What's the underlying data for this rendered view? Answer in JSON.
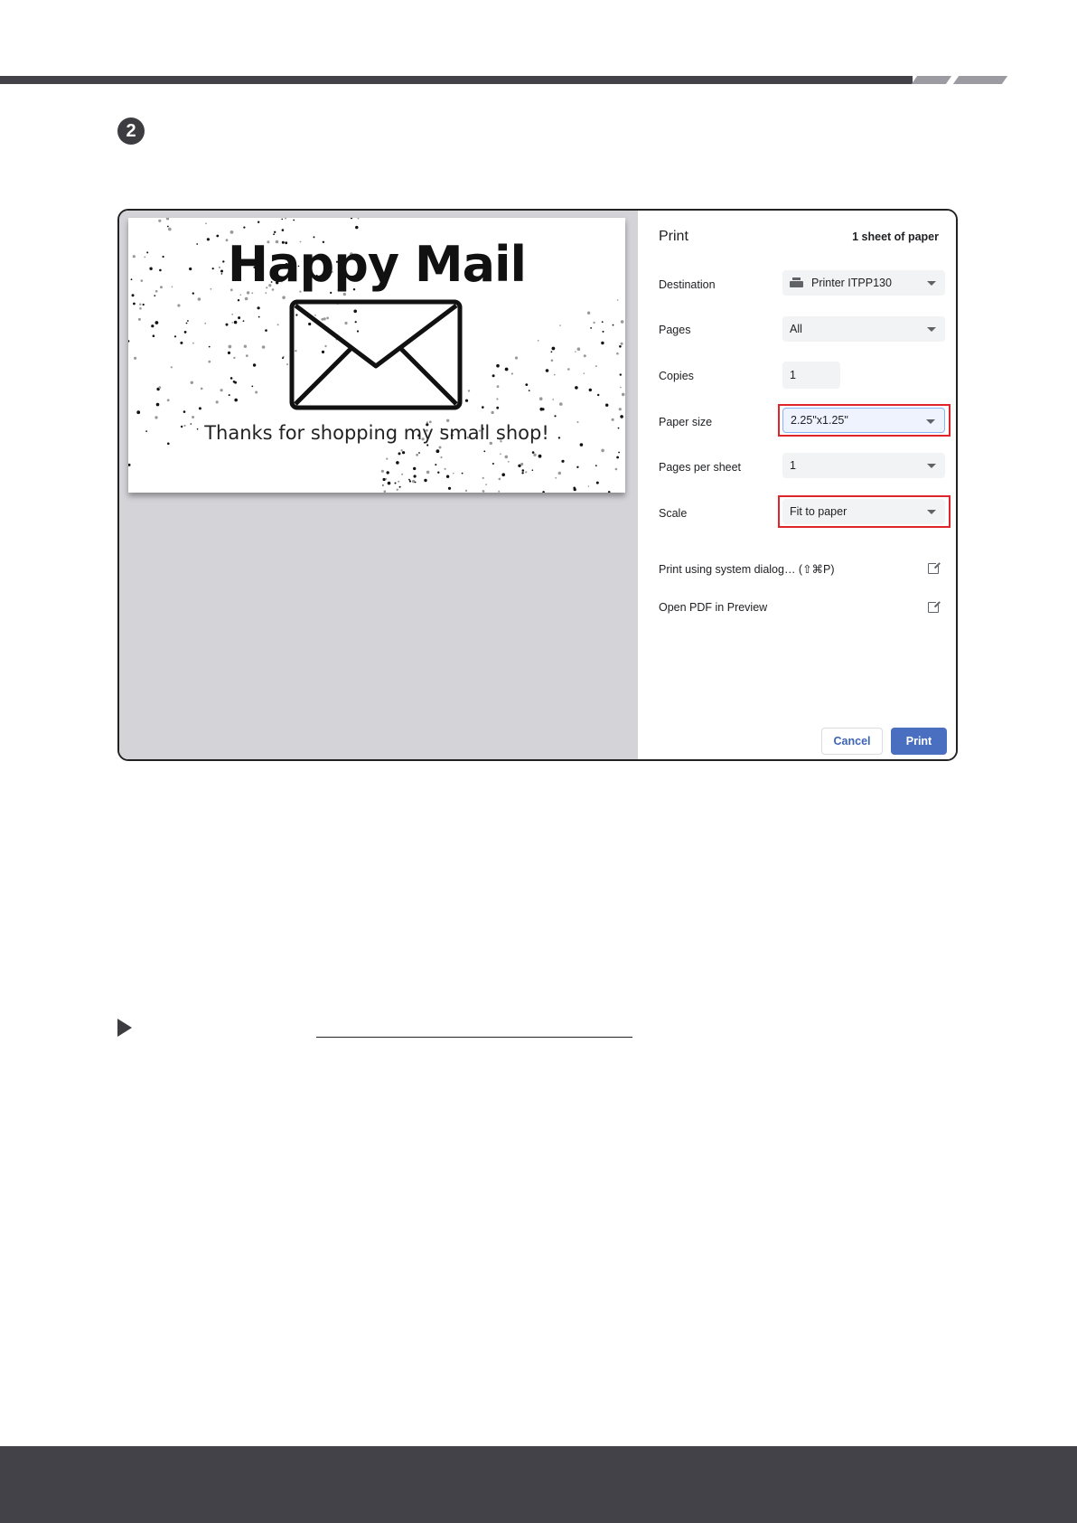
{
  "step": {
    "number": "2"
  },
  "preview": {
    "title": "Happy Mail",
    "message": "Thanks for shopping my small shop!"
  },
  "print_dialog": {
    "heading": "Print",
    "sheet_count": "1 sheet of paper",
    "destination": {
      "label": "Destination",
      "value": "Printer ITPP130"
    },
    "pages": {
      "label": "Pages",
      "value": "All"
    },
    "copies": {
      "label": "Copies",
      "value": "1"
    },
    "paper_size": {
      "label": "Paper size",
      "value": "2.25\"x1.25\""
    },
    "pages_per_sheet": {
      "label": "Pages per sheet",
      "value": "1"
    },
    "scale": {
      "label": "Scale",
      "value": "Fit to paper"
    },
    "system_dialog_link": "Print using system dialog… (⇧⌘P)",
    "open_pdf_link": "Open PDF in Preview",
    "cancel_label": "Cancel",
    "print_label": "Print"
  },
  "colors": {
    "highlight": "#e0252a",
    "primary_button": "#4a6fc0",
    "header_bar": "#434249"
  }
}
